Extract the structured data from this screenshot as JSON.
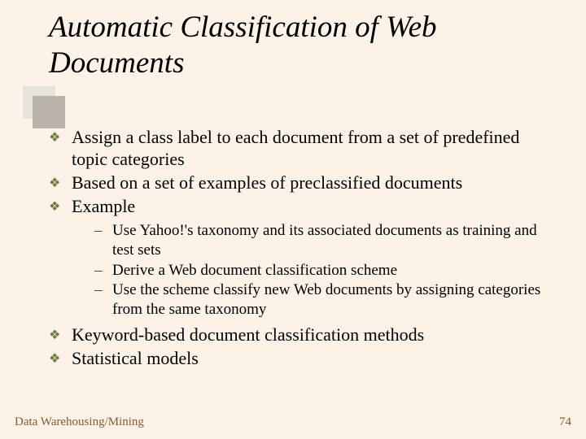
{
  "title": "Automatic Classification of Web Documents",
  "bullets": [
    {
      "text": "Assign a class label to each document from a set of predefined topic categories"
    },
    {
      "text": "Based on a set of examples of preclassified documents"
    },
    {
      "text": "Example",
      "sub": [
        "Use Yahoo!'s taxonomy and its associated documents as training and test sets",
        "Derive a Web document classification scheme",
        "Use the scheme classify new Web documents by assigning categories from the same taxonomy"
      ]
    },
    {
      "text": "Keyword-based document classification methods"
    },
    {
      "text": "Statistical models"
    }
  ],
  "footer": {
    "left": "Data Warehousing/Mining",
    "page": "74"
  },
  "glyphs": {
    "diamond": "❖",
    "dash": "–"
  }
}
